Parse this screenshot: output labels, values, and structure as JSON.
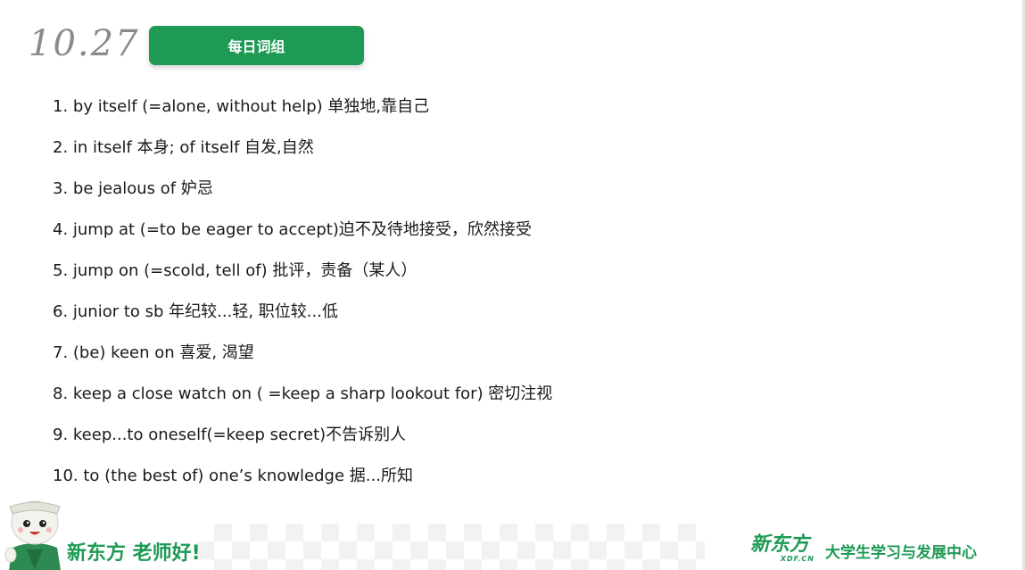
{
  "header": {
    "date": "10.27",
    "title": "每日词组"
  },
  "phrases": [
    "1. by itself (=alone, without help) 单独地,靠自己",
    "2. in itself 本身; of itself 自发,自然",
    "3. be jealous of 妒忌",
    "4. jump at (=to be eager to accept)迫不及待地接受，欣然接受",
    "5. jump on (=scold, tell of) 批评，责备（某人）",
    "6. junior to sb 年纪较...轻, 职位较...低",
    "7. (be) keen on 喜爱, 渴望",
    "8. keep a close watch on ( =keep a sharp lookout for) 密切注视",
    "9. keep...to oneself(=keep secret)不告诉别人",
    "10. to (the best of) one’s knowledge 据...所知"
  ],
  "footer": {
    "slogan": "新东方 老师好!",
    "logo_cn": "新东方",
    "logo_en": "XDF.CN",
    "center_name": "大学生学习与发展中心"
  },
  "colors": {
    "accent": "#1f9a55",
    "date_gray": "#8a8a8a"
  }
}
